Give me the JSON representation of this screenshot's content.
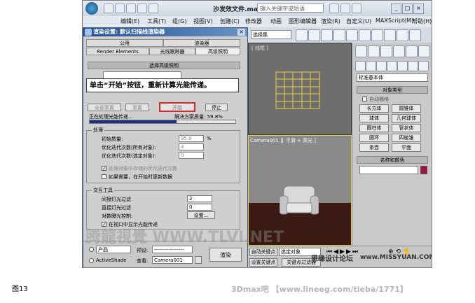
{
  "app": {
    "title": "沙发效文件.max",
    "search_placeholder": "键入关键字或短语"
  },
  "menus": [
    "编辑(E)",
    "工具(T)",
    "组(G)",
    "视图(V)",
    "创建(C)",
    "修改器",
    "动画",
    "图形编辑器",
    "渲染(R)",
    "自定义(U)",
    "MAXScript(M)",
    "帮助(H)"
  ],
  "toolbar": {
    "selection_filter": "选择集"
  },
  "viewports": {
    "top_label": "[ 线框 ]",
    "camera_label": "Camera001 ][ 平滑 + 高光 ]"
  },
  "command_panel": {
    "category": "标准基本体",
    "object_type_title": "对象类型",
    "autogrid": "自动栅格",
    "objects": [
      "长方体",
      "圆锥体",
      "球体",
      "几何球体",
      "圆柱体",
      "管状体",
      "圆环",
      "四棱锥",
      "茶壶",
      "平面"
    ],
    "name_color_title": "名称和颜色"
  },
  "dialog": {
    "title": "渲染设置: 默认扫描线渲染器",
    "tabs_row1": [
      "公用",
      "渲染器"
    ],
    "tabs_row2": [
      "Render Elements",
      "光线跟踪器",
      "高级照明"
    ],
    "section_select": "选择高级照明",
    "btn_reset_all": "全部重置",
    "btn_reset": "重置",
    "btn_start": "开始",
    "btn_stop": "停止",
    "progress_text": "正在处理光能传递...",
    "quality_text": "解决方案质量: 59.8%",
    "progress": 0.598,
    "processing_title": "处理",
    "initial_quality_label": "初始质量:",
    "initial_quality_value": "95.0",
    "initial_quality_unit": "%",
    "refine_all_label": "优化迭代次数(所有对象):",
    "refine_all_value": "4",
    "refine_sel_label": "优化迭代次数(选定对象):",
    "refine_sel_value": "0",
    "chk_process_refine": "处理对象中存储的优化迭代次数",
    "chk_update_data": "如果需要，在开始时更新数据",
    "interactive_title": "交互工具",
    "indirect_filter_label": "间接灯光过滤",
    "indirect_filter_value": "2",
    "direct_filter_label": "直接灯光过滤",
    "direct_filter_value": "0",
    "exposure_label": "对数曝光控制:",
    "exposure_btn": "设置...",
    "chk_display_vp": "在视口中显示光能传递",
    "product_label": "产品",
    "activeshade_label": "ActiveShade",
    "preset_label": "预设:",
    "preset_value": "-----------------",
    "view_label": "查看:",
    "view_value": "Camera001",
    "render_btn": "渲染"
  },
  "bottom_bar": {
    "auto_key": "自动关键点",
    "set_key": "设置关键点",
    "selected": "选定对象",
    "key_filter": "关键点过滤器"
  },
  "callout": "单击“开始”按钮，重新计算光能传递。",
  "watermarks": {
    "main": "腾龍視覺 WWW.TLVI.NET",
    "forum": "思缘设计论坛",
    "missyuan": "www.MISSYUAN.COM"
  },
  "figure_label": "图13",
  "footer": "3Dmax吧 【www.lineeg.com/tieba/1771】"
}
